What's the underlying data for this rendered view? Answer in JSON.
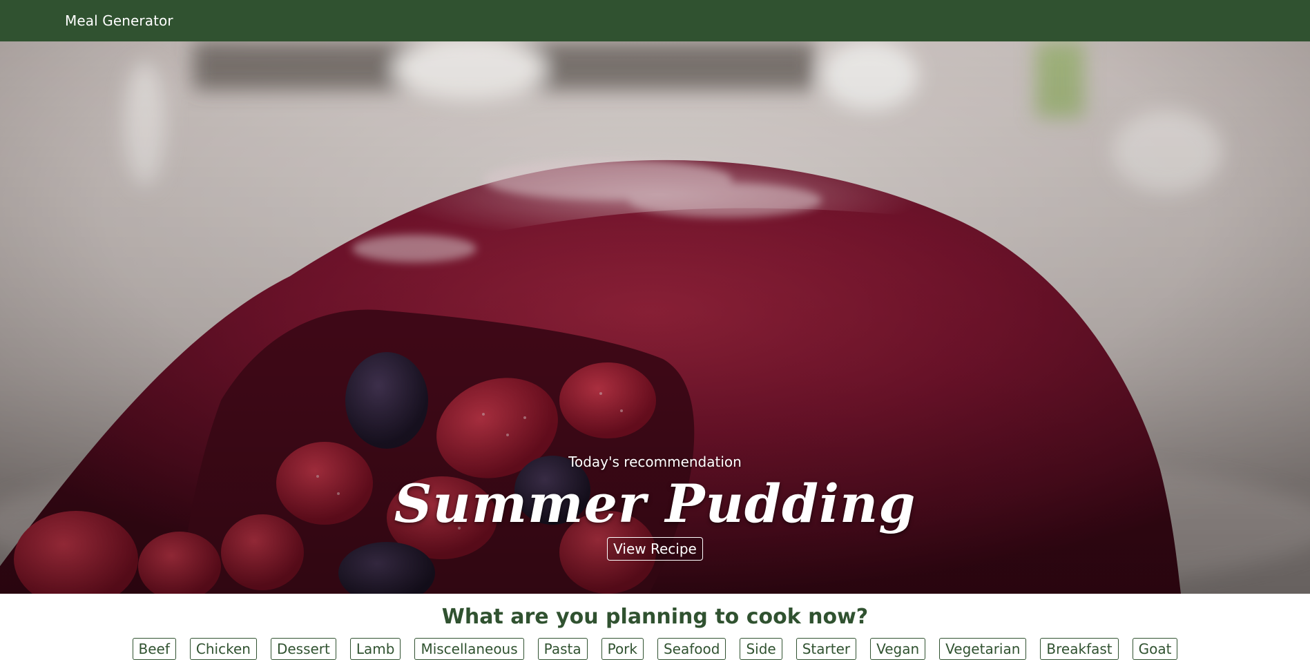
{
  "navbar": {
    "brand": "Meal Generator",
    "background_color": "#305230"
  },
  "hero": {
    "subtitle": "Today's recommendation",
    "meal_name": "Summer Pudding",
    "button_label": "View Recipe"
  },
  "planning": {
    "heading": "What are you planning to cook now?",
    "categories": [
      "Beef",
      "Chicken",
      "Dessert",
      "Lamb",
      "Miscellaneous",
      "Pasta",
      "Pork",
      "Seafood",
      "Side",
      "Starter",
      "Vegan",
      "Vegetarian",
      "Breakfast",
      "Goat"
    ],
    "accent_color": "#305230"
  }
}
